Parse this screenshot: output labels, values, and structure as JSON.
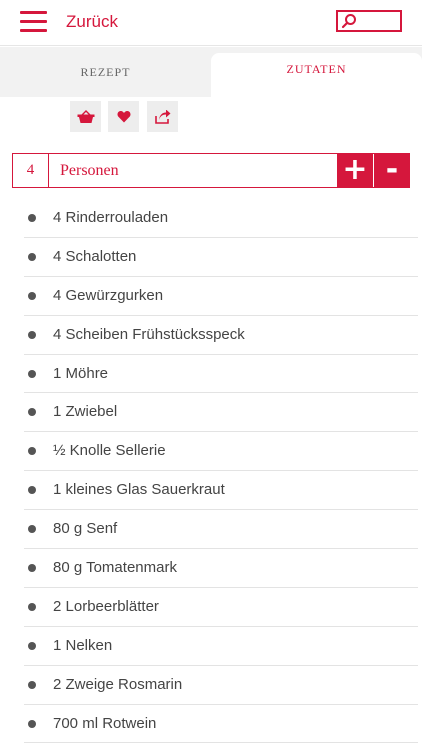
{
  "header": {
    "back_label": "Zurück",
    "menu_icon": "hamburger-menu-icon",
    "search_icon": "search-icon"
  },
  "tabs": [
    {
      "label": "REZEPT",
      "active": false
    },
    {
      "label": "ZUTATEN",
      "active": true
    }
  ],
  "actions": [
    {
      "icon": "basket-icon"
    },
    {
      "icon": "heart-icon"
    },
    {
      "icon": "share-icon"
    }
  ],
  "persons": {
    "count": "4",
    "label": "Personen",
    "plus_label": "+",
    "minus_label": "-"
  },
  "ingredients": [
    "4 Rinderrouladen",
    "4 Schalotten",
    "4 Gewürzgurken",
    "4 Scheiben Frühstücksspeck",
    "1 Möhre",
    "1 Zwiebel",
    "½ Knolle Sellerie",
    "1 kleines Glas Sauerkraut",
    "80 g Senf",
    "80 g Tomatenmark",
    "2 Lorbeerblätter",
    "1 Nelken",
    "2 Zweige Rosmarin",
    "700 ml Rotwein"
  ],
  "colors": {
    "accent": "#d5173c",
    "tab_background": "#f2f2f2",
    "button_background": "#ededed"
  }
}
